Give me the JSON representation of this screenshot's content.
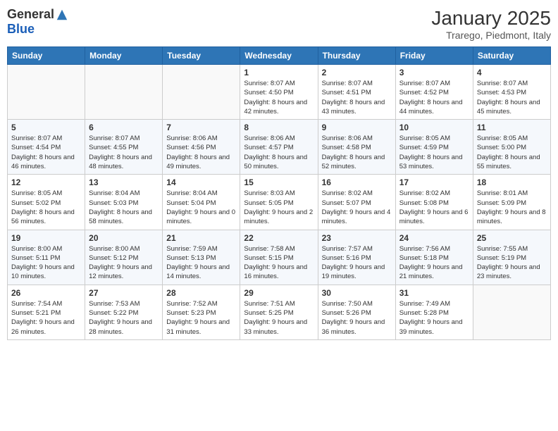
{
  "header": {
    "logo_general": "General",
    "logo_blue": "Blue",
    "month_title": "January 2025",
    "location": "Trarego, Piedmont, Italy"
  },
  "days_of_week": [
    "Sunday",
    "Monday",
    "Tuesday",
    "Wednesday",
    "Thursday",
    "Friday",
    "Saturday"
  ],
  "weeks": [
    [
      {
        "day": "",
        "info": ""
      },
      {
        "day": "",
        "info": ""
      },
      {
        "day": "",
        "info": ""
      },
      {
        "day": "1",
        "info": "Sunrise: 8:07 AM\nSunset: 4:50 PM\nDaylight: 8 hours and 42 minutes."
      },
      {
        "day": "2",
        "info": "Sunrise: 8:07 AM\nSunset: 4:51 PM\nDaylight: 8 hours and 43 minutes."
      },
      {
        "day": "3",
        "info": "Sunrise: 8:07 AM\nSunset: 4:52 PM\nDaylight: 8 hours and 44 minutes."
      },
      {
        "day": "4",
        "info": "Sunrise: 8:07 AM\nSunset: 4:53 PM\nDaylight: 8 hours and 45 minutes."
      }
    ],
    [
      {
        "day": "5",
        "info": "Sunrise: 8:07 AM\nSunset: 4:54 PM\nDaylight: 8 hours and 46 minutes."
      },
      {
        "day": "6",
        "info": "Sunrise: 8:07 AM\nSunset: 4:55 PM\nDaylight: 8 hours and 48 minutes."
      },
      {
        "day": "7",
        "info": "Sunrise: 8:06 AM\nSunset: 4:56 PM\nDaylight: 8 hours and 49 minutes."
      },
      {
        "day": "8",
        "info": "Sunrise: 8:06 AM\nSunset: 4:57 PM\nDaylight: 8 hours and 50 minutes."
      },
      {
        "day": "9",
        "info": "Sunrise: 8:06 AM\nSunset: 4:58 PM\nDaylight: 8 hours and 52 minutes."
      },
      {
        "day": "10",
        "info": "Sunrise: 8:05 AM\nSunset: 4:59 PM\nDaylight: 8 hours and 53 minutes."
      },
      {
        "day": "11",
        "info": "Sunrise: 8:05 AM\nSunset: 5:00 PM\nDaylight: 8 hours and 55 minutes."
      }
    ],
    [
      {
        "day": "12",
        "info": "Sunrise: 8:05 AM\nSunset: 5:02 PM\nDaylight: 8 hours and 56 minutes."
      },
      {
        "day": "13",
        "info": "Sunrise: 8:04 AM\nSunset: 5:03 PM\nDaylight: 8 hours and 58 minutes."
      },
      {
        "day": "14",
        "info": "Sunrise: 8:04 AM\nSunset: 5:04 PM\nDaylight: 9 hours and 0 minutes."
      },
      {
        "day": "15",
        "info": "Sunrise: 8:03 AM\nSunset: 5:05 PM\nDaylight: 9 hours and 2 minutes."
      },
      {
        "day": "16",
        "info": "Sunrise: 8:02 AM\nSunset: 5:07 PM\nDaylight: 9 hours and 4 minutes."
      },
      {
        "day": "17",
        "info": "Sunrise: 8:02 AM\nSunset: 5:08 PM\nDaylight: 9 hours and 6 minutes."
      },
      {
        "day": "18",
        "info": "Sunrise: 8:01 AM\nSunset: 5:09 PM\nDaylight: 9 hours and 8 minutes."
      }
    ],
    [
      {
        "day": "19",
        "info": "Sunrise: 8:00 AM\nSunset: 5:11 PM\nDaylight: 9 hours and 10 minutes."
      },
      {
        "day": "20",
        "info": "Sunrise: 8:00 AM\nSunset: 5:12 PM\nDaylight: 9 hours and 12 minutes."
      },
      {
        "day": "21",
        "info": "Sunrise: 7:59 AM\nSunset: 5:13 PM\nDaylight: 9 hours and 14 minutes."
      },
      {
        "day": "22",
        "info": "Sunrise: 7:58 AM\nSunset: 5:15 PM\nDaylight: 9 hours and 16 minutes."
      },
      {
        "day": "23",
        "info": "Sunrise: 7:57 AM\nSunset: 5:16 PM\nDaylight: 9 hours and 19 minutes."
      },
      {
        "day": "24",
        "info": "Sunrise: 7:56 AM\nSunset: 5:18 PM\nDaylight: 9 hours and 21 minutes."
      },
      {
        "day": "25",
        "info": "Sunrise: 7:55 AM\nSunset: 5:19 PM\nDaylight: 9 hours and 23 minutes."
      }
    ],
    [
      {
        "day": "26",
        "info": "Sunrise: 7:54 AM\nSunset: 5:21 PM\nDaylight: 9 hours and 26 minutes."
      },
      {
        "day": "27",
        "info": "Sunrise: 7:53 AM\nSunset: 5:22 PM\nDaylight: 9 hours and 28 minutes."
      },
      {
        "day": "28",
        "info": "Sunrise: 7:52 AM\nSunset: 5:23 PM\nDaylight: 9 hours and 31 minutes."
      },
      {
        "day": "29",
        "info": "Sunrise: 7:51 AM\nSunset: 5:25 PM\nDaylight: 9 hours and 33 minutes."
      },
      {
        "day": "30",
        "info": "Sunrise: 7:50 AM\nSunset: 5:26 PM\nDaylight: 9 hours and 36 minutes."
      },
      {
        "day": "31",
        "info": "Sunrise: 7:49 AM\nSunset: 5:28 PM\nDaylight: 9 hours and 39 minutes."
      },
      {
        "day": "",
        "info": ""
      }
    ]
  ]
}
